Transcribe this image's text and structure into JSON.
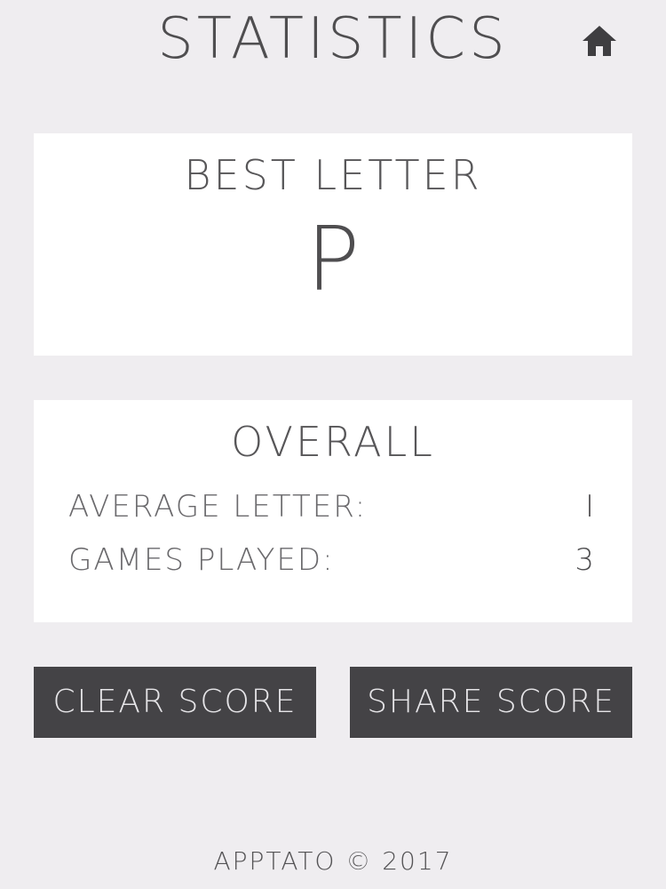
{
  "header": {
    "title": "STATISTICS",
    "home_icon": "home-icon"
  },
  "best": {
    "heading": "BEST LETTER",
    "value": "P"
  },
  "overall": {
    "heading": "OVERALL",
    "rows": [
      {
        "label": "AVERAGE LETTER:",
        "value": "I"
      },
      {
        "label": "GAMES PLAYED:",
        "value": "3"
      }
    ]
  },
  "buttons": {
    "clear_label": "CLEAR SCORE",
    "share_label": "SHARE SCORE"
  },
  "footer": {
    "text": "APPTATO © 2017"
  },
  "colors": {
    "background": "#efedf0",
    "card": "#ffffff",
    "button": "#444346"
  }
}
